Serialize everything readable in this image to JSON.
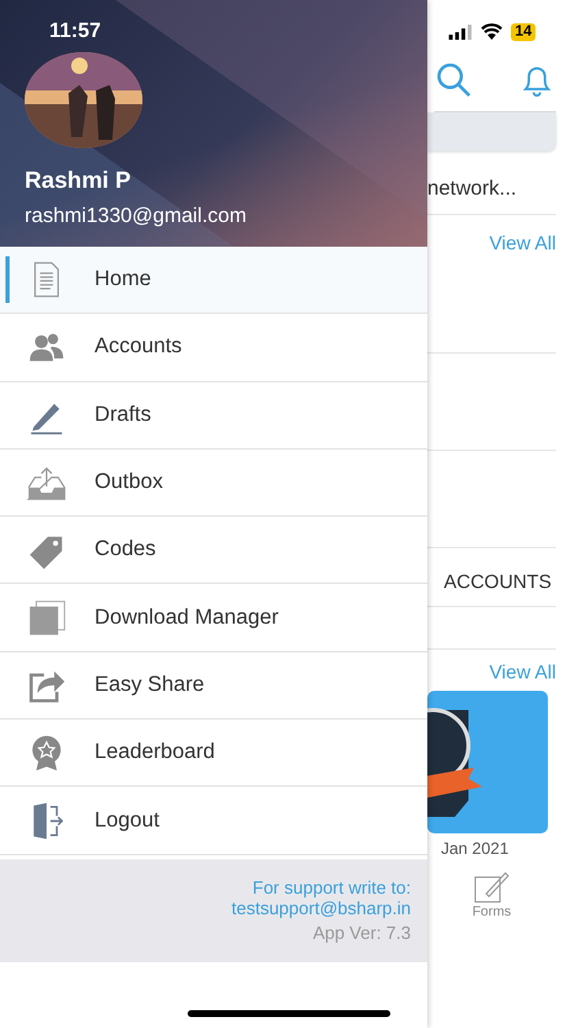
{
  "status_bar": {
    "time": "11:57",
    "battery": "14"
  },
  "drawer": {
    "profile": {
      "name": "Rashmi P",
      "email": "rashmi1330@gmail.com"
    },
    "menu": [
      {
        "label": "Home",
        "selected": true
      },
      {
        "label": "Accounts",
        "selected": false
      },
      {
        "label": "Drafts",
        "selected": false
      },
      {
        "label": "Outbox",
        "selected": false
      },
      {
        "label": "Codes",
        "selected": false
      },
      {
        "label": "Download Manager",
        "selected": false
      },
      {
        "label": "Easy Share",
        "selected": false
      },
      {
        "label": "Leaderboard",
        "selected": false
      },
      {
        "label": "Logout",
        "selected": false
      }
    ],
    "footer": {
      "support_label": "For support write to:",
      "support_email": "testsupport@bsharp.in",
      "version": "App Ver: 7.3"
    }
  },
  "background_screen": {
    "snippet": "network...",
    "view_all_1": "View All",
    "section": "ACCOUNTS",
    "view_all_2": "View All",
    "date": "Jan 2021",
    "tab": "Forms"
  }
}
